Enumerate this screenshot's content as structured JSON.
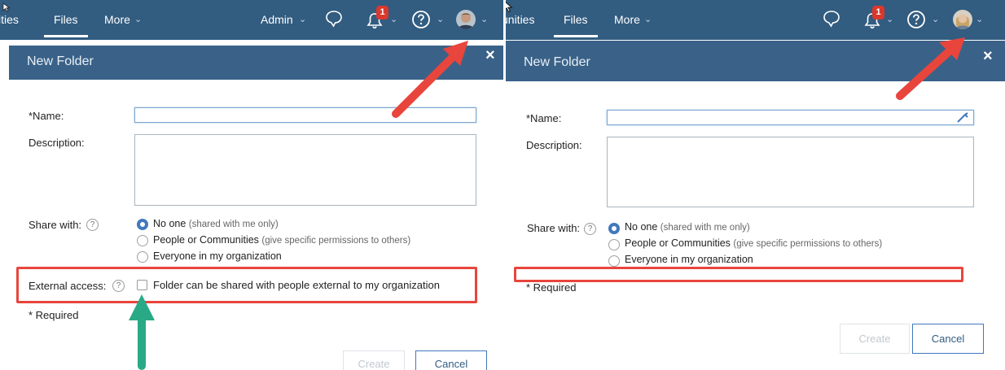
{
  "left": {
    "nav": {
      "partial_item": "ities",
      "files": "Files",
      "more": "More",
      "admin": "Admin",
      "notif_count": "1"
    },
    "dialog": {
      "title": "New Folder",
      "close": "×",
      "name_label": "*Name:",
      "description_label": "Description:",
      "share_label": "Share with:",
      "options": [
        {
          "label": "No one",
          "hint": "(shared with me only)",
          "checked": true
        },
        {
          "label": "People or Communities",
          "hint": "(give specific permissions to others)",
          "checked": false
        },
        {
          "label": "Everyone in my organization",
          "hint": "",
          "checked": false
        }
      ],
      "external_label": "External access:",
      "external_checkbox": "Folder can be shared with people external to my organization",
      "required_note": "* Required",
      "create": "Create",
      "cancel": "Cancel"
    }
  },
  "right": {
    "nav": {
      "partial_item": "unities",
      "files": "Files",
      "more": "More",
      "notif_count": "1"
    },
    "dialog": {
      "title": "New Folder",
      "close": "×",
      "name_label": "*Name:",
      "description_label": "Description:",
      "share_label": "Share with:",
      "options": [
        {
          "label": "No one",
          "hint": "(shared with me only)",
          "checked": true
        },
        {
          "label": "People or Communities",
          "hint": "(give specific permissions to others)",
          "checked": false
        },
        {
          "label": "Everyone in my organization",
          "hint": "",
          "checked": false
        }
      ],
      "required_note": "* Required",
      "create": "Create",
      "cancel": "Cancel"
    }
  },
  "colors": {
    "navbar": "#325c80",
    "dialog_header": "#3a6288",
    "radio_selected": "#4178be",
    "highlight_red": "#e8453c",
    "arrow_green": "#2aa987",
    "notification_badge": "#d9382c"
  },
  "icons": [
    "chat-bubble-icon",
    "bell-icon",
    "help-circle-icon",
    "avatar",
    "chevron-down-icon",
    "close-icon",
    "help-icon",
    "pen-icon",
    "mouse-pointer-icon"
  ]
}
